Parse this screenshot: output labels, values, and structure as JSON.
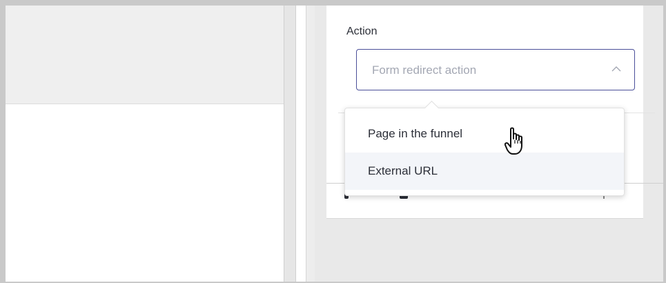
{
  "form_settings": {
    "action_label": "Action",
    "action_select": {
      "placeholder": "Form redirect action",
      "state": "open"
    },
    "action_options": [
      {
        "label": "Page in the funnel",
        "hovered": true
      },
      {
        "label": "External URL",
        "hovered": false
      }
    ]
  },
  "colors": {
    "select_border": "#4a4f99",
    "placeholder_text": "#a3a7b3",
    "text": "#2c2f38",
    "panel_background": "#e9e9e9"
  },
  "icons": {
    "select_chevron": "chevron-up-icon",
    "cursor": "hand-pointer-icon"
  }
}
